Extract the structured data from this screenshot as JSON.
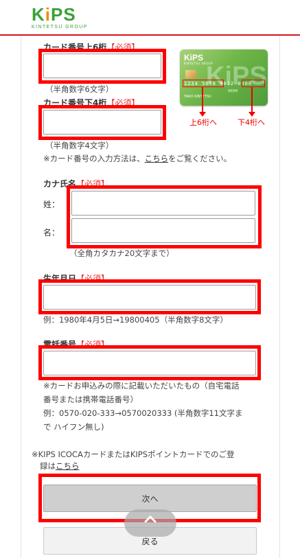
{
  "header": {
    "logo_word_k": "K",
    "logo_word_i": "i",
    "logo_word_ps": "PS",
    "logo_sub": "KINTETSU GROUP"
  },
  "card_image": {
    "word": "KiPS",
    "sub": "KINTETSU GROUP",
    "big": "KiPS",
    "number": "1234 5678 9012 0000",
    "name": "TARO KINTETSU",
    "exp": "00/00",
    "arrow_left_label": "上6桁へ",
    "arrow_right_label": "下4桁へ"
  },
  "card_upper": {
    "label": "カード番号上6桁",
    "required": "【必須】",
    "value": "",
    "note": "（半角数字6文字）"
  },
  "card_lower": {
    "label": "カード番号下4桁",
    "required": "【必須】",
    "value": "",
    "note": "（半角数字4文字）",
    "help_prefix": "※カード番号の入力方法は、",
    "help_link": "こちら",
    "help_suffix": "をご覧ください。"
  },
  "kana_name": {
    "label": "カナ氏名",
    "required": "【必須】",
    "sei_label": "姓：",
    "mei_label": "名：",
    "sei_value": "",
    "mei_value": "",
    "note": "（全角カタカナ20文字まで）"
  },
  "birthdate": {
    "label": "生年月日",
    "required": "【必須】",
    "value": "",
    "note": "例：1980年4月5日→19800405（半角数字8文字）"
  },
  "phone": {
    "label": "電話番号",
    "required": "【必須】",
    "value": "",
    "note1": "※カードお申込みの際に記載いただいたもの（自宅電話",
    "note2": "番号または携帯電話番号）",
    "note3": "例：0570-020-333→0570020333 (半角数字11文字ま",
    "note4": "で ハイフン無し)"
  },
  "footer_note": {
    "line1": "※KIPS ICOCAカードまたはKIPSポイントカードでのご登",
    "line2_prefix": "録は",
    "line2_link": "こちら"
  },
  "buttons": {
    "next": "次へ",
    "back": "戻る"
  },
  "colors": {
    "brand_green": "#3aa136",
    "header_red": "#d9121b",
    "required_red": "#e03232",
    "highlight_red": "#ff0000"
  }
}
